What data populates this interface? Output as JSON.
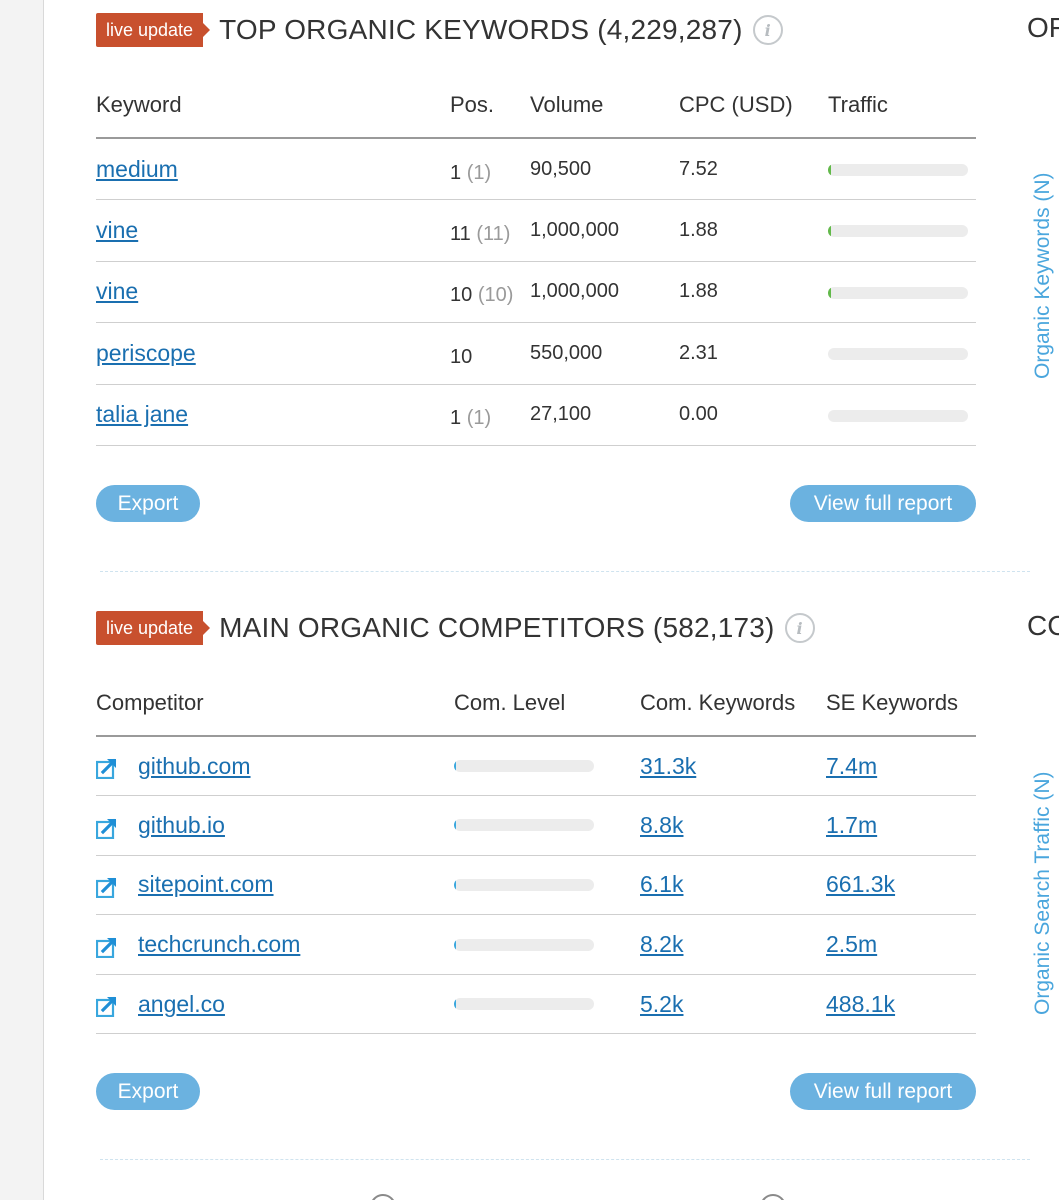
{
  "keywords_panel": {
    "badge": "live update",
    "title": "TOP ORGANIC KEYWORDS (4,229,287)",
    "info_icon": "info-icon",
    "columns": [
      "Keyword",
      "Pos.",
      "Volume",
      "CPC (USD)",
      "Traffic"
    ],
    "rows": [
      {
        "keyword": "medium",
        "pos": "1",
        "prev_pos": "(1)",
        "volume": "90,500",
        "cpc": "7.52",
        "traffic_fraction": 0.02
      },
      {
        "keyword": "vine",
        "pos": "11",
        "prev_pos": "(11)",
        "volume": "1,000,000",
        "cpc": "1.88",
        "traffic_fraction": 0.01
      },
      {
        "keyword": "vine",
        "pos": "10",
        "prev_pos": "(10)",
        "volume": "1,000,000",
        "cpc": "1.88",
        "traffic_fraction": 0.01
      },
      {
        "keyword": "periscope",
        "pos": "10",
        "prev_pos": "",
        "volume": "550,000",
        "cpc": "2.31",
        "traffic_fraction": 0.0
      },
      {
        "keyword": "talia jane",
        "pos": "1",
        "prev_pos": "(1)",
        "volume": "27,100",
        "cpc": "0.00",
        "traffic_fraction": 0.0
      }
    ],
    "export_label": "Export",
    "full_report_label": "View full report"
  },
  "competitors_panel": {
    "badge": "live update",
    "title": "MAIN ORGANIC COMPETITORS (582,173)",
    "info_icon": "info-icon",
    "columns": [
      "Competitor",
      "Com. Level",
      "Com. Keywords",
      "SE Keywords"
    ],
    "rows": [
      {
        "domain": "github.com",
        "level_fraction": 0.01,
        "com_keywords": "31.3k",
        "se_keywords": "7.4m"
      },
      {
        "domain": "github.io",
        "level_fraction": 0.01,
        "com_keywords": "8.8k",
        "se_keywords": "1.7m"
      },
      {
        "domain": "sitepoint.com",
        "level_fraction": 0.01,
        "com_keywords": "6.1k",
        "se_keywords": "661.3k"
      },
      {
        "domain": "techcrunch.com",
        "level_fraction": 0.01,
        "com_keywords": "8.2k",
        "se_keywords": "2.5m"
      },
      {
        "domain": "angel.co",
        "level_fraction": 0.01,
        "com_keywords": "5.2k",
        "se_keywords": "488.1k"
      }
    ],
    "row_icon": "external-link-icon",
    "export_label": "Export",
    "full_report_label": "View full report"
  },
  "right_column": {
    "heading_1": "OF",
    "heading_2": "CC",
    "vertical_label_1": "Organic Keywords (N)",
    "vertical_label_2": "Organic Search Traffic (N)"
  },
  "colors": {
    "badge": "#c8502e",
    "link": "#1a6fb0",
    "button": "#6bb2e0",
    "traffic_fill": "#62b94a",
    "level_fill": "#39a7de",
    "vertical_label": "#4aa6dd"
  }
}
